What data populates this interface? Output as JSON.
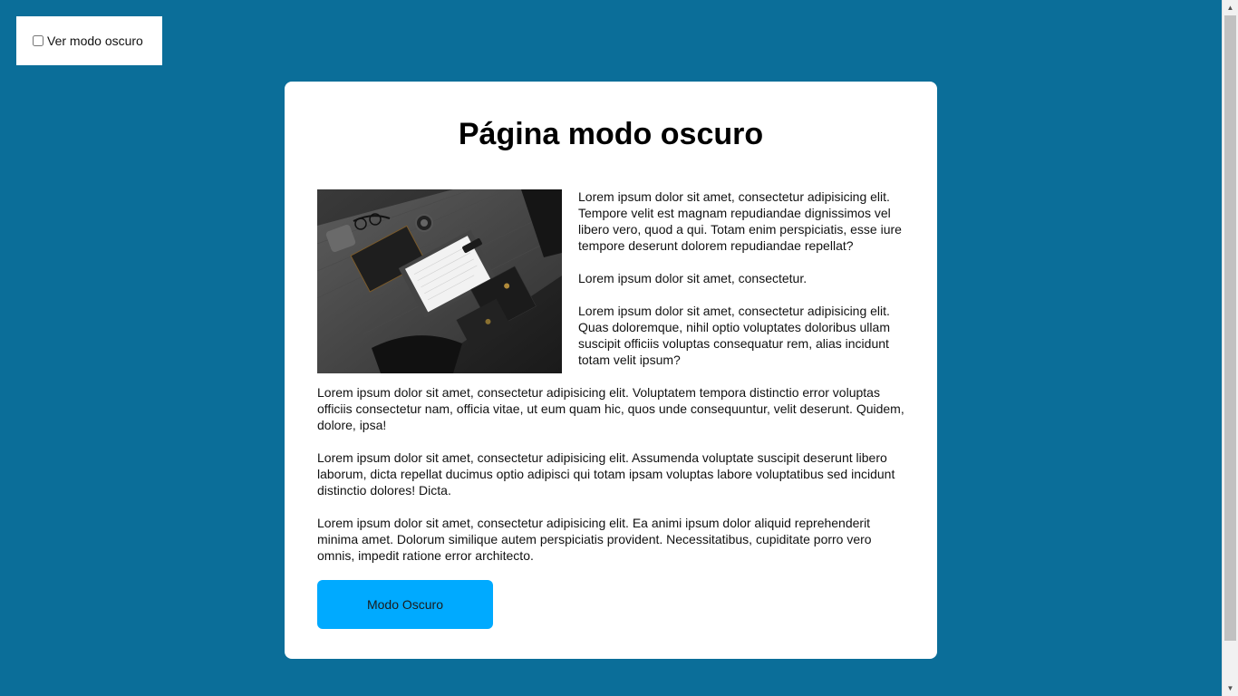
{
  "toggle": {
    "label": "Ver modo oscuro",
    "checked": false
  },
  "card": {
    "title": "Página modo oscuro",
    "image_icon": "desk-stationery-photo",
    "paragraphs": [
      "Lorem ipsum dolor sit amet, consectetur adipisicing elit. Tempore velit est magnam repudiandae dignissimos vel libero vero, quod a qui. Totam enim perspiciatis, esse iure tempore deserunt dolorem repudiandae repellat?",
      "Lorem ipsum dolor sit amet, consectetur.",
      "Lorem ipsum dolor sit amet, consectetur adipisicing elit. Quas doloremque, nihil optio voluptates doloribus ullam suscipit officiis voluptas consequatur rem, alias incidunt totam velit ipsum?",
      "Lorem ipsum dolor sit amet, consectetur adipisicing elit. Voluptatem tempora distinctio error voluptas officiis consectetur nam, officia vitae, ut eum quam hic, quos unde consequuntur, velit deserunt. Quidem, dolore, ipsa!",
      "Lorem ipsum dolor sit amet, consectetur adipisicing elit. Assumenda voluptate suscipit deserunt libero laborum, dicta repellat ducimus optio adipisci qui totam ipsam voluptas labore voluptatibus sed incidunt distinctio dolores! Dicta.",
      "Lorem ipsum dolor sit amet, consectetur adipisicing elit. Ea animi ipsum dolor aliquid reprehenderit minima amet. Dolorum similique autem perspiciatis provident. Necessitatibus, cupiditate porro vero omnis, impedit ratione error architecto."
    ],
    "button_label": "Modo Oscuro"
  },
  "colors": {
    "background": "#0b6e99",
    "card": "#ffffff",
    "button": "#00aaff"
  }
}
